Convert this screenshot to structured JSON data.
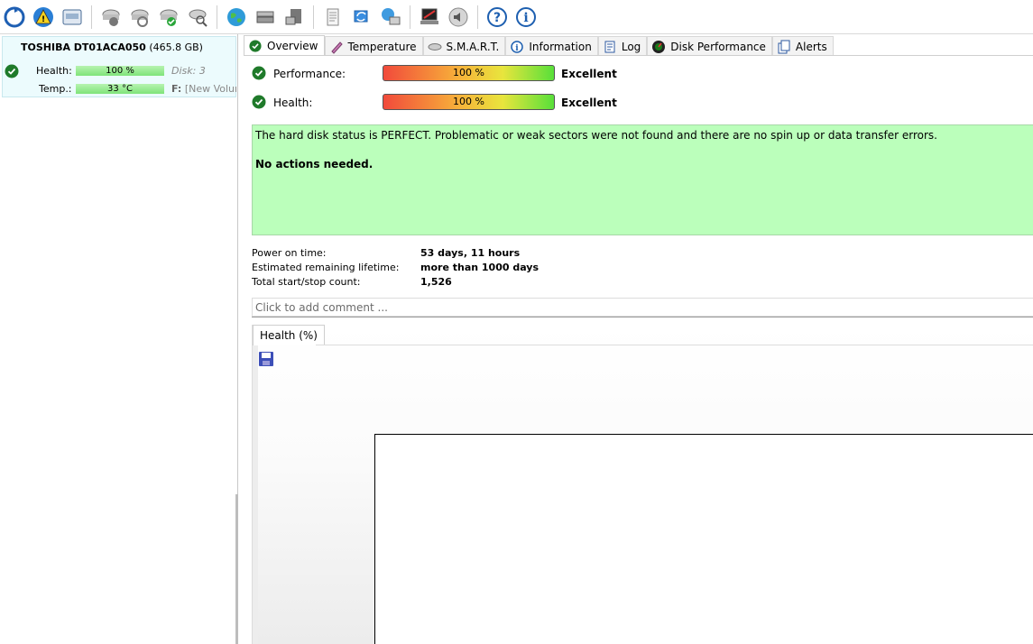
{
  "toolbar": {
    "buttons": [
      {
        "name": "refresh-icon"
      },
      {
        "name": "warning-icon"
      },
      {
        "name": "hard-disk-icon"
      },
      {
        "name": "disk-alert-icon"
      },
      {
        "name": "disk-refresh-icon"
      },
      {
        "name": "disk-ok-icon"
      },
      {
        "name": "disk-search-icon"
      },
      {
        "name": "globe-icon"
      },
      {
        "name": "server-icon"
      },
      {
        "name": "drive-icon"
      },
      {
        "name": "document-icon"
      },
      {
        "name": "sync-icon"
      },
      {
        "name": "network-icon"
      },
      {
        "name": "laptop-icon"
      },
      {
        "name": "speaker-icon"
      },
      {
        "name": "help-icon"
      },
      {
        "name": "info-icon"
      }
    ]
  },
  "disk": {
    "model": "TOSHIBA DT01ACA050",
    "size": "(465.8 GB)",
    "health_label": "Health:",
    "health_value": "100 %",
    "health_fraction": 1.0,
    "disk_label": "Disk: 3",
    "temp_label": "Temp.:",
    "temp_value": "33 °C",
    "volume_prefix": "F:",
    "volume_name": "[New Volum"
  },
  "tabs": [
    {
      "label": "Overview",
      "icon": "check-icon",
      "active": true
    },
    {
      "label": "Temperature",
      "icon": "thermometer-icon",
      "active": false
    },
    {
      "label": "S.M.A.R.T.",
      "icon": "smart-icon",
      "active": false
    },
    {
      "label": "Information",
      "icon": "info-icon",
      "active": false
    },
    {
      "label": "Log",
      "icon": "log-icon",
      "active": false
    },
    {
      "label": "Disk Performance",
      "icon": "gauge-icon",
      "active": false
    },
    {
      "label": "Alerts",
      "icon": "alerts-icon",
      "active": false
    }
  ],
  "overview": {
    "performance_label": "Performance:",
    "performance_value": "100 %",
    "performance_status": "Excellent",
    "health_label": "Health:",
    "health_value": "100 %",
    "health_status": "Excellent",
    "status_message": "The hard disk status is PERFECT. Problematic or weak sectors were not found and there are no spin up or data transfer errors.",
    "action_message": "No actions needed.",
    "power_on_label": "Power on time:",
    "power_on_value": "53 days, 11 hours",
    "lifetime_label": "Estimated remaining lifetime:",
    "lifetime_value": "more than 1000 days",
    "startstop_label": "Total start/stop count:",
    "startstop_value": "1,526",
    "comment_placeholder": "Click to add comment ...",
    "chart_tab_label": "Health (%)"
  },
  "colors": {
    "status_green": "#bbffbb",
    "selected_disk": "#ecfbfd",
    "ok_green": "#1f7a2a"
  }
}
